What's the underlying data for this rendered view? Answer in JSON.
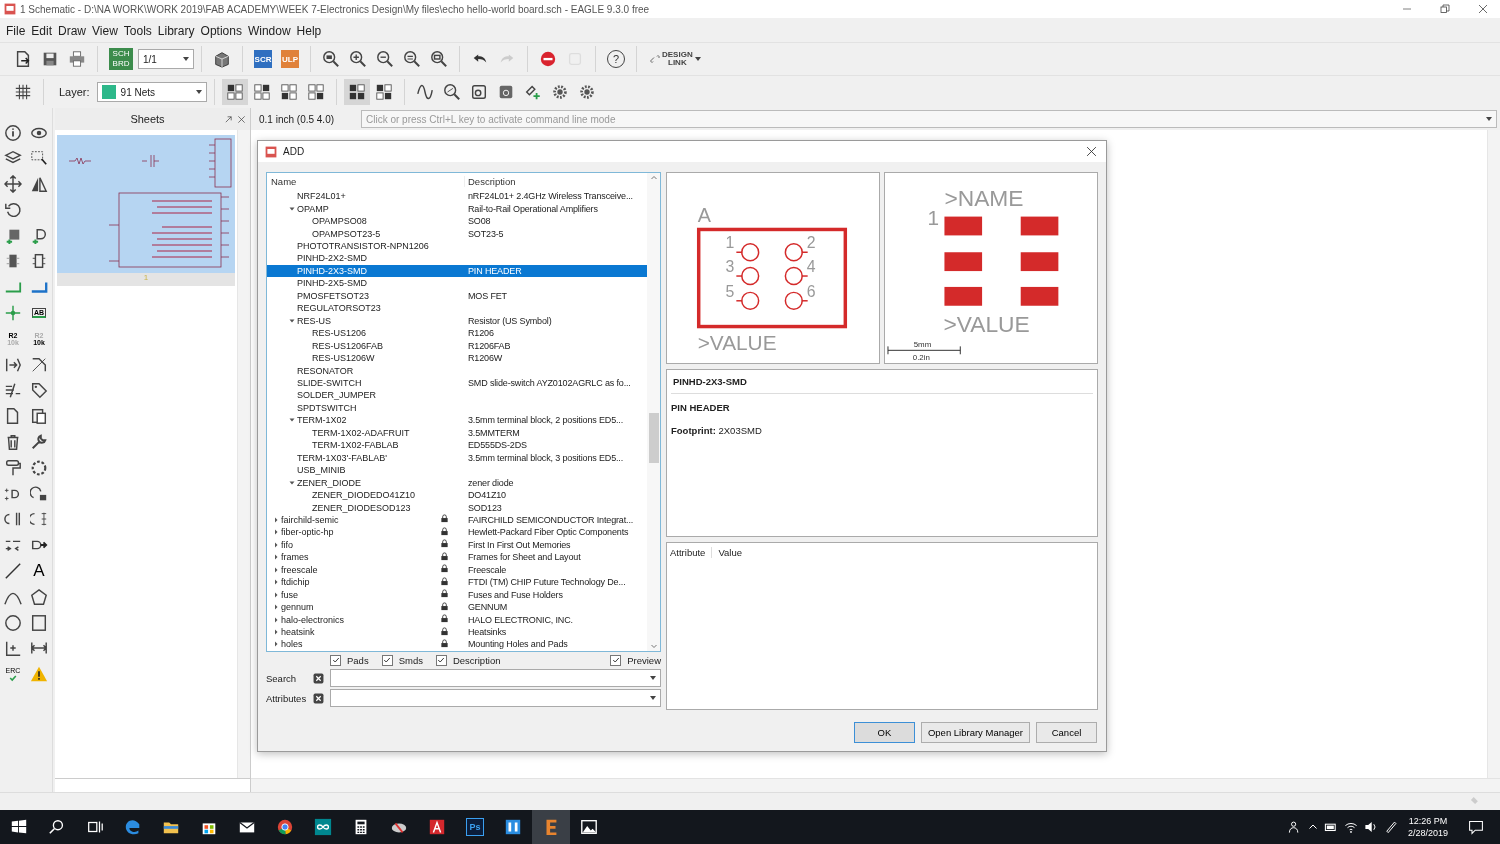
{
  "window": {
    "title": "1 Schematic - D:\\NA WORK\\WORK 2019\\FAB ACADEMY\\WEEK 7-Electronics Design\\My files\\echo hello-world board.sch - EAGLE 9.3.0 free"
  },
  "menu": [
    "File",
    "Edit",
    "Draw",
    "View",
    "Tools",
    "Library",
    "Options",
    "Window",
    "Help"
  ],
  "toolbar": {
    "editor_switch": [
      "SCH",
      "BRD"
    ],
    "sheet": "1/1",
    "script": "SCR",
    "ulp": "ULP",
    "help": "?",
    "design_link": [
      "DESIGN",
      "LINK"
    ]
  },
  "toolbar_2": {
    "layer_label": "Layer:",
    "layer": "91 Nets",
    "display_modes": [
      {
        "selected": true
      },
      {
        "selected": false
      },
      {
        "selected": false
      },
      {
        "selected": false
      }
    ],
    "view_modes": [
      {
        "selected": true
      },
      {
        "selected": false
      }
    ]
  },
  "tool_column": {
    "value_tool": [
      "R2",
      "10k"
    ],
    "smash_tool": [
      "R2",
      "10k"
    ],
    "label_tool": "AB",
    "text_tool": "A",
    "erc_tool": "ERC"
  },
  "sheets_panel": {
    "title": "Sheets",
    "sheet_number": "1"
  },
  "coordinates": "0.1 inch (0.5 4.0)",
  "command_line": {
    "placeholder": "Click or press Ctrl+L key to activate command line mode"
  },
  "add_dialog": {
    "title": "ADD",
    "columns": [
      "Name",
      "Description"
    ],
    "rows": [
      {
        "kind": "device",
        "name": "NRF24L01+",
        "description": "nRF24L01+ 2.4GHz Wireless Transceive...",
        "selected": false
      },
      {
        "kind": "device",
        "name": "OPAMP",
        "description": "Rail-to-Rail Operational Amplifiers",
        "selected": false,
        "expanded": true,
        "children": [
          {
            "name": "OPAMPSO08",
            "description": "SO08",
            "selected": false
          },
          {
            "name": "OPAMPSOT23-5",
            "description": "SOT23-5",
            "selected": false
          }
        ]
      },
      {
        "kind": "device",
        "name": "PHOTOTRANSISTOR-NPN1206",
        "selected": false
      },
      {
        "kind": "device",
        "name": "PINHD-2X2-SMD",
        "selected": false
      },
      {
        "kind": "device",
        "name": "PINHD-2X3-SMD",
        "description": "PIN HEADER",
        "selected": true
      },
      {
        "kind": "device",
        "name": "PINHD-2X5-SMD",
        "selected": false
      },
      {
        "kind": "device",
        "name": "PMOSFETSOT23",
        "description": "MOS FET",
        "selected": false
      },
      {
        "kind": "device",
        "name": "REGULATORSOT23",
        "selected": false
      },
      {
        "kind": "device",
        "name": "RES-US",
        "description": "Resistor (US Symbol)",
        "selected": false,
        "expanded": true,
        "children": [
          {
            "name": "RES-US1206",
            "description": "R1206",
            "selected": false
          },
          {
            "name": "RES-US1206FAB",
            "description": "R1206FAB",
            "selected": false
          },
          {
            "name": "RES-US1206W",
            "description": "R1206W",
            "selected": false
          }
        ]
      },
      {
        "kind": "device",
        "name": "RESONATOR",
        "selected": false
      },
      {
        "kind": "device",
        "name": "SLIDE-SWITCH",
        "description": "SMD slide-switch AYZ0102AGRLC as fo...",
        "selected": false
      },
      {
        "kind": "device",
        "name": "SOLDER_JUMPER",
        "selected": false
      },
      {
        "kind": "device",
        "name": "SPDTSWITCH",
        "selected": false
      },
      {
        "kind": "device",
        "name": "TERM-1X02",
        "description": "3.5mm terminal block, 2 positions ED5...",
        "selected": false,
        "expanded": true,
        "children": [
          {
            "name": "TERM-1X02-ADAFRUIT",
            "description": "3.5MMTERM",
            "selected": false
          },
          {
            "name": "TERM-1X02-FABLAB",
            "description": "ED555DS-2DS",
            "selected": false
          }
        ]
      },
      {
        "kind": "device",
        "name": "TERM-1X03'-FABLAB'",
        "description": "3.5mm terminal block, 3 positions ED5...",
        "selected": false
      },
      {
        "kind": "device",
        "name": "USB_MINIB",
        "selected": false
      },
      {
        "kind": "device",
        "name": "ZENER_DIODE",
        "description": "zener diode",
        "selected": false,
        "expanded": true,
        "children": [
          {
            "name": "ZENER_DIODEDO41Z10",
            "description": "DO41Z10",
            "selected": false
          },
          {
            "name": "ZENER_DIODESOD123",
            "description": "SOD123",
            "selected": false
          }
        ]
      },
      {
        "kind": "library",
        "name": "fairchild-semic",
        "description": "FAIRCHILD SEMICONDUCTOR Integrat...",
        "selected": false,
        "expanded": false
      },
      {
        "kind": "library",
        "name": "fiber-optic-hp",
        "description": "Hewlett-Packard Fiber Optic Components",
        "selected": false,
        "expanded": false
      },
      {
        "kind": "library",
        "name": "fifo",
        "description": "First In First Out Memories",
        "selected": false,
        "expanded": false
      },
      {
        "kind": "library",
        "name": "frames",
        "description": "Frames for Sheet and Layout",
        "selected": false,
        "expanded": false
      },
      {
        "kind": "library",
        "name": "freescale",
        "description": "Freescale",
        "selected": false,
        "expanded": false
      },
      {
        "kind": "library",
        "name": "ftdichip",
        "description": "FTDI (TM) CHIP Future Technology De...",
        "selected": false,
        "expanded": false
      },
      {
        "kind": "library",
        "name": "fuse",
        "description": "Fuses and Fuse Holders",
        "selected": false,
        "expanded": false
      },
      {
        "kind": "library",
        "name": "gennum",
        "description": "GENNUM",
        "selected": false,
        "expanded": false
      },
      {
        "kind": "library",
        "name": "halo-electronics",
        "description": "HALO ELECTRONIC, INC.",
        "selected": false,
        "expanded": false
      },
      {
        "kind": "library",
        "name": "heatsink",
        "description": "Heatsinks",
        "selected": false,
        "expanded": false
      },
      {
        "kind": "library",
        "name": "holes",
        "description": "Mounting Holes and Pads",
        "selected": false,
        "expanded": false
      }
    ],
    "filters": [
      {
        "label": "Pads",
        "checked": true
      },
      {
        "label": "Smds",
        "checked": true
      },
      {
        "label": "Description",
        "checked": true
      }
    ],
    "preview_toggle": {
      "label": "Preview",
      "checked": true
    },
    "search": {
      "label": "Search"
    },
    "attributes_filter": {
      "label": "Attributes"
    },
    "symbol_preview": {
      "gate": "A",
      "pins": [
        "1",
        "2",
        "3",
        "4",
        "5",
        "6"
      ],
      "value": ">VALUE"
    },
    "package_preview": {
      "name": ">NAME",
      "pin_one": "1",
      "value": ">VALUE",
      "scale": [
        "5mm",
        "0.2in"
      ]
    },
    "info": {
      "name": "PINHD-2X3-SMD",
      "description": "PIN HEADER",
      "footprint": "**Footprint:** 2X03SMD"
    },
    "attribute_columns": [
      "Attribute",
      "Value"
    ],
    "buttons": [
      {
        "label": "OK",
        "default": true
      },
      {
        "label": "Open Library Manager",
        "default": false
      },
      {
        "label": "Cancel",
        "default": false
      }
    ]
  },
  "taskbar": {
    "photoshop": "Ps",
    "time": "12:26 PM",
    "date": "2/28/2019"
  }
}
